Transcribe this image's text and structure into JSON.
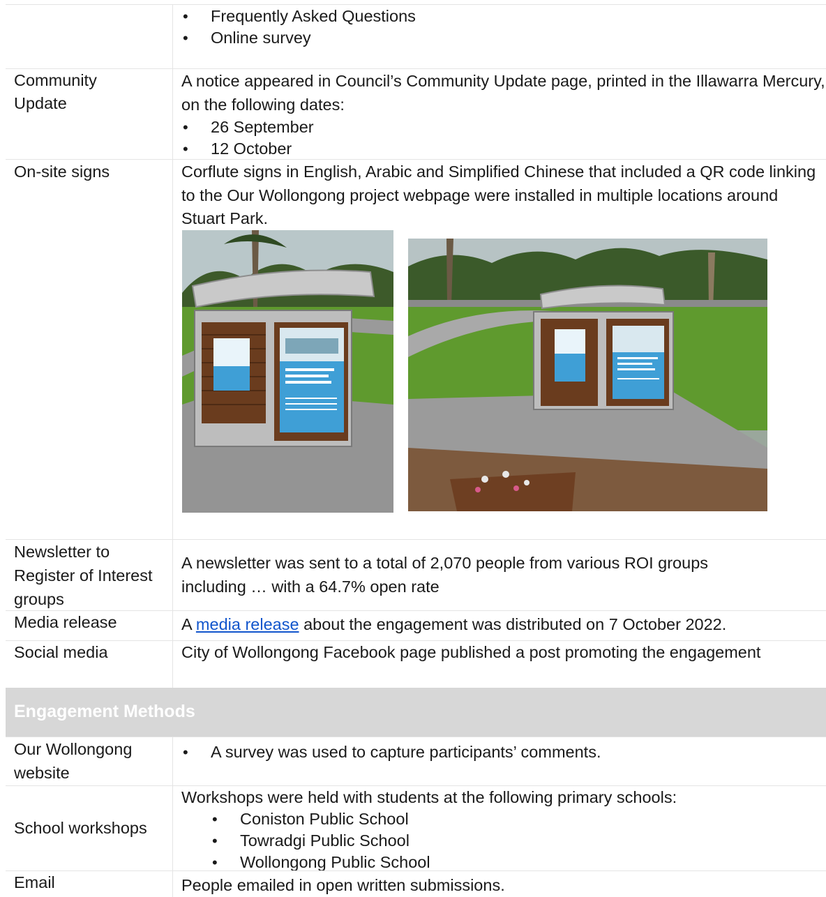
{
  "top_bullets": [
    "Frequently Asked Questions",
    "Online survey"
  ],
  "rows": {
    "community_update": {
      "label": "Community Update",
      "text": "A notice appeared in Council’s Community Update page, printed in the Illawarra Mercury, on the following dates:",
      "bullets": [
        "26 September",
        "12 October"
      ]
    },
    "onsite_signs": {
      "label": "On-site signs",
      "text": "Corflute signs in English, Arabic and Simplified Chinese that included a QR code linking to the Our Wollongong project webpage were installed in multiple locations around Stuart Park."
    },
    "newsletter": {
      "label": "Newsletter to Register of Interest groups",
      "text": "A newsletter was sent to a total of 2,070 people from various ROI groups including … with a 64.7% open rate"
    },
    "media_release": {
      "label": "Media release",
      "text_before": "A",
      "link": "media release",
      "text_after": "about the engagement was distributed on 7 October 2022."
    },
    "social_media": {
      "label": "Social media",
      "text": "City of Wollongong Facebook page published a post promoting the engagement"
    }
  },
  "section_heading": "Engagement Methods",
  "methods": {
    "website": {
      "label": "Our Wollongong website",
      "bullets": [
        "A survey was used to capture participants’ comments."
      ]
    },
    "schools": {
      "label": "School workshops",
      "text": "Workshops were held with students at the following primary schools:",
      "bullets": [
        "Coniston Public School",
        "Towradgi Public School",
        "Wollongong Public School"
      ]
    },
    "email": {
      "label": "Email",
      "text": "People emailed in open written submissions."
    }
  },
  "colors": {
    "link": "#1155cc",
    "section_heading_bg": "#d7d7d7",
    "section_heading_text": "#ffffff",
    "grass": "#5f9a2e",
    "path": "#a9a9a9",
    "timber": "#6a3c1e",
    "poster": "#3f9fd6"
  }
}
